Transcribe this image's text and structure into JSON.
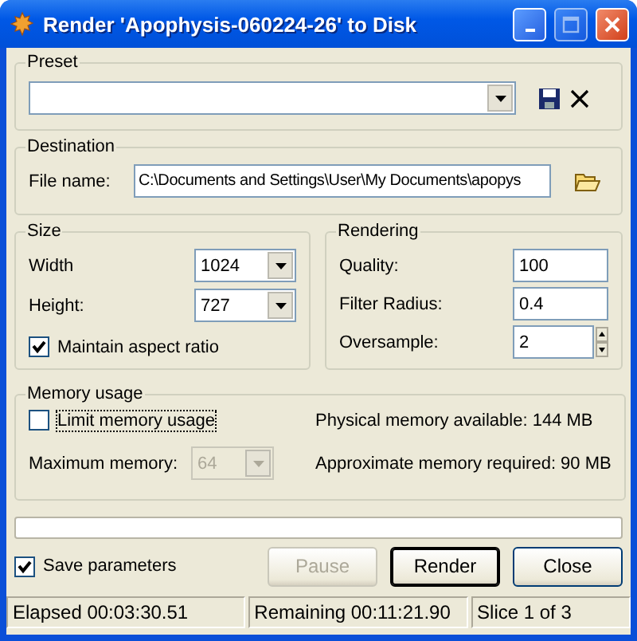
{
  "window": {
    "title": "Render 'Apophysis-060224-26' to Disk"
  },
  "preset": {
    "label": "Preset"
  },
  "destination": {
    "label": "Destination",
    "file_label": "File name:",
    "file_value": "C:\\Documents and Settings\\User\\My Documents\\apopys"
  },
  "size": {
    "label": "Size",
    "fields": [
      {
        "label": "Width",
        "value": "1024"
      },
      {
        "label": "Height:",
        "value": "727"
      }
    ],
    "maintain_aspect": {
      "label": "Maintain aspect ratio",
      "checked": true
    }
  },
  "rendering": {
    "label": "Rendering",
    "fields": [
      {
        "label": "Quality:",
        "value": "100",
        "kind": "text"
      },
      {
        "label": "Filter Radius:",
        "value": "0.4",
        "kind": "text"
      },
      {
        "label": "Oversample:",
        "value": "2",
        "kind": "spin"
      }
    ]
  },
  "memory": {
    "label": "Memory usage",
    "limit": {
      "label": "Limit memory usage",
      "checked": false,
      "focused": true
    },
    "maximum": {
      "label": "Maximum memory:",
      "value": "64",
      "disabled": true
    },
    "physical": "Physical memory available: 144 MB",
    "required": "Approximate memory required: 90 MB"
  },
  "save_parameters": {
    "label": "Save parameters",
    "checked": true
  },
  "buttons": [
    {
      "label": "Pause",
      "disabled": true,
      "default": false
    },
    {
      "label": "Render",
      "disabled": false,
      "default": true
    },
    {
      "label": "Close",
      "disabled": false,
      "default": false
    }
  ],
  "status_bar": [
    "Elapsed 00:03:30.51",
    "Remaining 00:11:21.90",
    "Slice 1 of 3"
  ]
}
